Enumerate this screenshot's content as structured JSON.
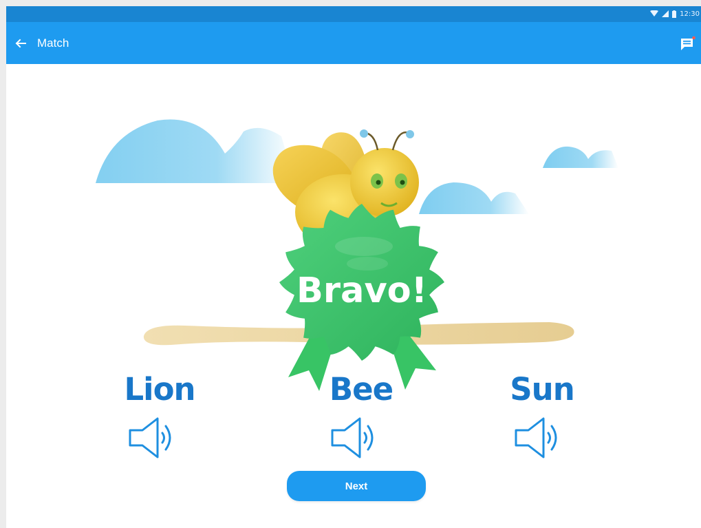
{
  "status_bar": {
    "time": "12:30"
  },
  "app_bar": {
    "title": "Match"
  },
  "feedback": {
    "badge_text": "Bravo!"
  },
  "choices": [
    {
      "word": "Lion"
    },
    {
      "word": "Bee"
    },
    {
      "word": "Sun"
    }
  ],
  "actions": {
    "next_label": "Next"
  },
  "colors": {
    "app_bar": "#1e9bf0",
    "status_bar": "#1985d2",
    "word_text": "#1977c9",
    "badge_green": "#3cc46a",
    "cloud_blue": "#8fd3ef",
    "sand": "#ead4a0"
  }
}
